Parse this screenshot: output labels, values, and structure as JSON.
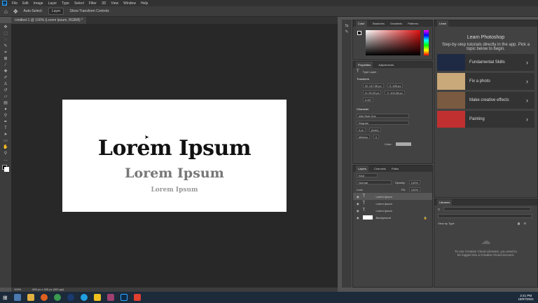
{
  "menu": [
    "File",
    "Edit",
    "Image",
    "Layer",
    "Type",
    "Select",
    "Filter",
    "3D",
    "View",
    "Window",
    "Help"
  ],
  "options": {
    "auto_select": "Auto-Select:",
    "layer": "Layer",
    "transform": "Show Transform Controls"
  },
  "doc_tab": "Untitled-1 @ 100% (Lorem Ipsum, RGB/8) *",
  "canvas_text": [
    "Lorem Ipsum",
    "Lorem Ipsum",
    "Lorem Ipsum"
  ],
  "status": {
    "zoom": "100%",
    "size": "800 px x 400 px (300 ppi)"
  },
  "color_tabs": [
    "Color",
    "Swatches",
    "Gradients",
    "Patterns"
  ],
  "properties": {
    "tabs": [
      "Properties",
      "Adjustments"
    ],
    "type": "Type Layer",
    "transform": "Transform",
    "w": "W: 147.35 px",
    "x": "X: 405 px",
    "h": "H: 25.33 px",
    "y": "Y: 104.48 px",
    "angle": "0.00°",
    "character": "Character",
    "font": "Alfa Slab One",
    "style": "Regular",
    "size": "0 pt",
    "leading": "(Auto)",
    "kerning": "Metrics",
    "tracking": "0",
    "color_label": "Color:"
  },
  "layers": {
    "tabs": [
      "Layers",
      "Channels",
      "Paths"
    ],
    "kind": "Kind",
    "blend": "Normal",
    "opacity_label": "Opacity:",
    "opacity": "100%",
    "lock_label": "Lock:",
    "fill_label": "Fill:",
    "fill": "100%",
    "items": [
      "Lorem Ipsum",
      "Lorem Ipsum",
      "Lorem Ipsum",
      "Background"
    ]
  },
  "learn": {
    "tab": "Learn",
    "title": "Learn Photoshop",
    "desc": "Step-by-step tutorials directly in the app. Pick a topic below to begin.",
    "cards": [
      "Fundamental Skills",
      "Fix a photo",
      "Make creative effects",
      "Painting"
    ]
  },
  "libraries": {
    "tab": "Libraries",
    "view": "View by Type",
    "message": "To use Creative Cloud Libraries, you need to be logged into a Creative Cloud account."
  },
  "taskbar": {
    "time": "2:41 PM",
    "date": "18/07/2021"
  }
}
